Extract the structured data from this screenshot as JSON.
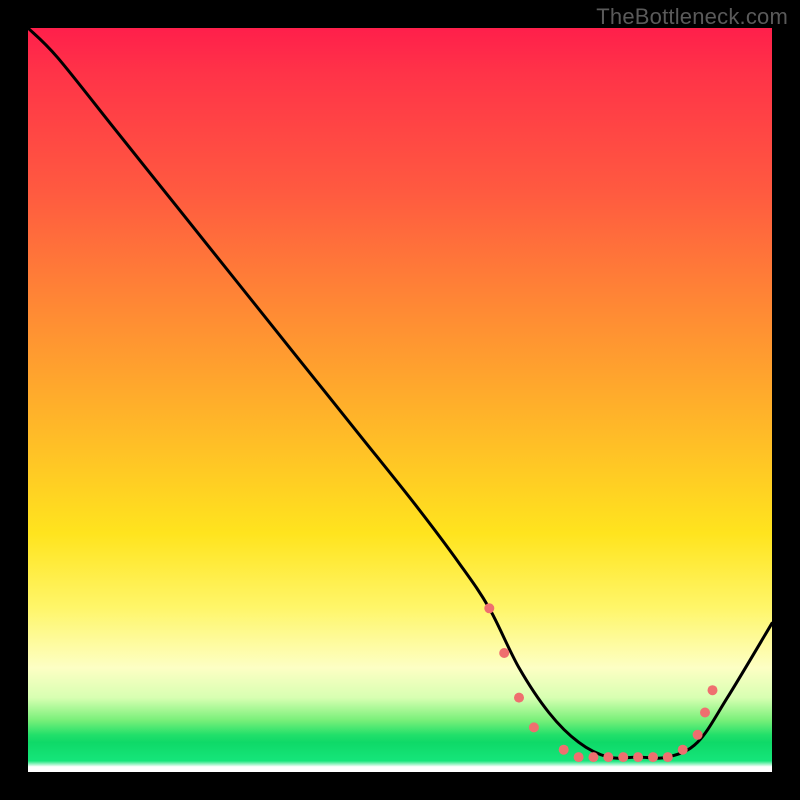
{
  "watermark": "TheBottleneck.com",
  "chart_data": {
    "type": "line",
    "title": "",
    "xlabel": "",
    "ylabel": "",
    "xlim": [
      0,
      100
    ],
    "ylim": [
      0,
      100
    ],
    "grid": false,
    "series": [
      {
        "name": "bottleneck-curve",
        "color": "#000000",
        "x": [
          0,
          4,
          12,
          20,
          28,
          36,
          44,
          52,
          58,
          62,
          66,
          70,
          74,
          78,
          82,
          86,
          90,
          94,
          100
        ],
        "values": [
          100,
          96,
          86,
          76,
          66,
          56,
          46,
          36,
          28,
          22,
          14,
          8,
          4,
          2,
          2,
          2,
          4,
          10,
          20
        ]
      }
    ],
    "dots": {
      "color": "#ef6f6f",
      "radius_px": 5,
      "points": [
        {
          "x": 62,
          "y": 22
        },
        {
          "x": 64,
          "y": 16
        },
        {
          "x": 66,
          "y": 10
        },
        {
          "x": 68,
          "y": 6
        },
        {
          "x": 72,
          "y": 3
        },
        {
          "x": 74,
          "y": 2
        },
        {
          "x": 76,
          "y": 2
        },
        {
          "x": 78,
          "y": 2
        },
        {
          "x": 80,
          "y": 2
        },
        {
          "x": 82,
          "y": 2
        },
        {
          "x": 84,
          "y": 2
        },
        {
          "x": 86,
          "y": 2
        },
        {
          "x": 88,
          "y": 3
        },
        {
          "x": 90,
          "y": 5
        },
        {
          "x": 91,
          "y": 8
        },
        {
          "x": 92,
          "y": 11
        }
      ]
    }
  }
}
